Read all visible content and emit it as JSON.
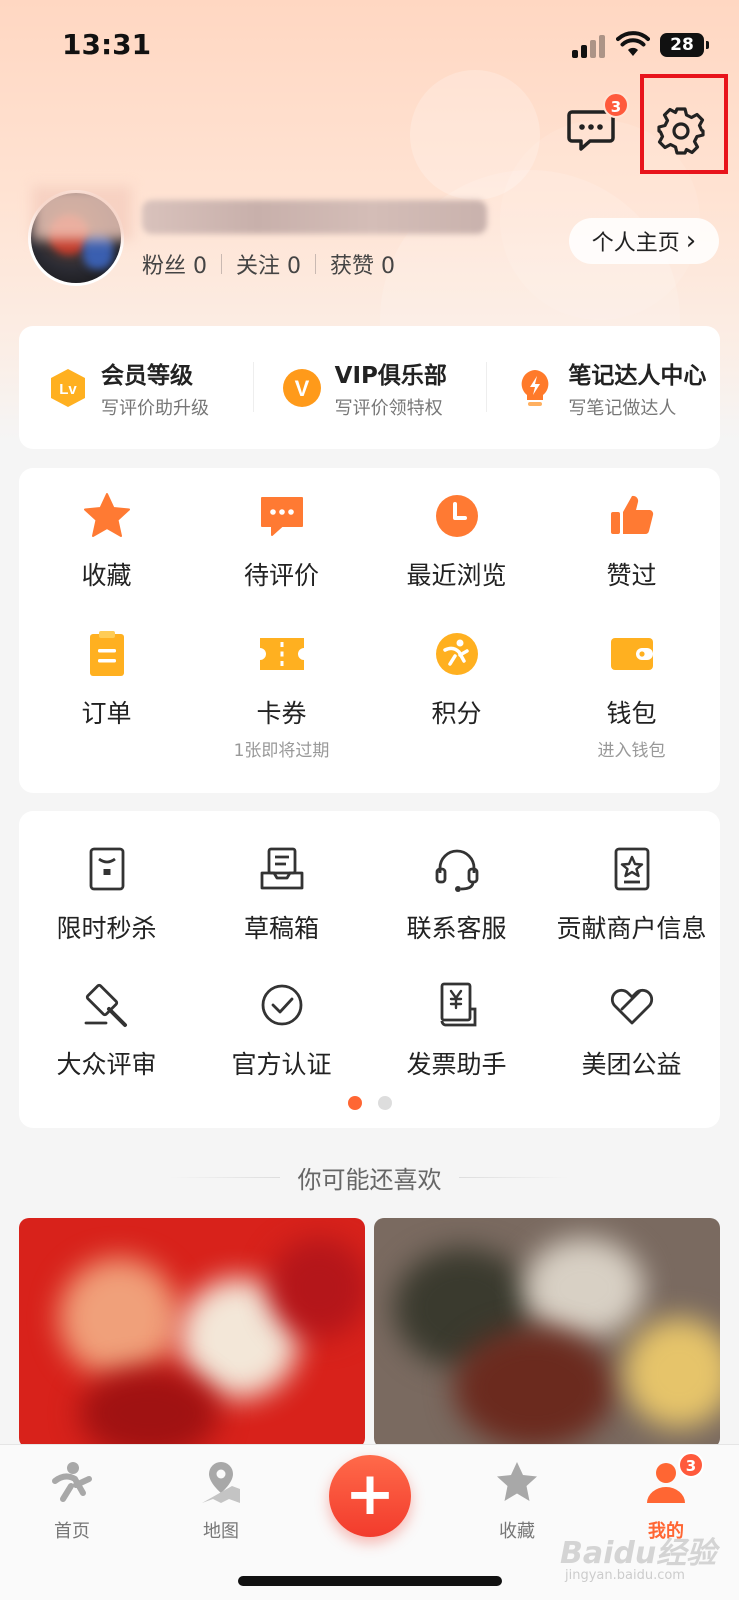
{
  "status_bar": {
    "time": "13:31",
    "battery": "28"
  },
  "header": {
    "message_badge": "3"
  },
  "profile": {
    "stats": [
      {
        "label": "粉丝",
        "value": "0"
      },
      {
        "label": "关注",
        "value": "0"
      },
      {
        "label": "获赞",
        "value": "0"
      }
    ],
    "homepage_label": "个人主页",
    "homepage_chevron": "›"
  },
  "member": [
    {
      "title": "会员等级",
      "subtitle": "写评价助升级",
      "icon": "lv-badge-icon",
      "icon_text": "Lv"
    },
    {
      "title": "VIP俱乐部",
      "subtitle": "写评价领特权",
      "icon": "vip-badge-icon",
      "icon_text": "V"
    },
    {
      "title": "笔记达人中心",
      "subtitle": "写笔记做达人",
      "icon": "bulb-icon"
    }
  ],
  "grid1": [
    {
      "label": "收藏",
      "sub": "",
      "icon": "star-icon"
    },
    {
      "label": "待评价",
      "sub": "",
      "icon": "comment-icon"
    },
    {
      "label": "最近浏览",
      "sub": "",
      "icon": "clock-icon"
    },
    {
      "label": "赞过",
      "sub": "",
      "icon": "thumbs-up-icon"
    },
    {
      "label": "订单",
      "sub": "",
      "icon": "order-icon"
    },
    {
      "label": "卡券",
      "sub": "1张即将过期",
      "icon": "ticket-icon"
    },
    {
      "label": "积分",
      "sub": "",
      "icon": "points-icon"
    },
    {
      "label": "钱包",
      "sub": "进入钱包",
      "icon": "wallet-icon"
    }
  ],
  "grid2": [
    {
      "label": "限时秒杀",
      "icon": "flash-sale-icon"
    },
    {
      "label": "草稿箱",
      "icon": "drafts-icon"
    },
    {
      "label": "联系客服",
      "icon": "headset-icon"
    },
    {
      "label": "贡献商户信息",
      "icon": "merchant-icon"
    },
    {
      "label": "大众评审",
      "icon": "gavel-icon"
    },
    {
      "label": "官方认证",
      "icon": "verified-icon"
    },
    {
      "label": "发票助手",
      "icon": "invoice-icon"
    },
    {
      "label": "美团公益",
      "icon": "charity-icon"
    }
  ],
  "recommend": {
    "title": "你可能还喜欢"
  },
  "tabbar": {
    "tabs": [
      {
        "label": "首页",
        "icon": "home-icon"
      },
      {
        "label": "地图",
        "icon": "map-icon"
      },
      {
        "label": "收藏",
        "icon": "favorites-icon"
      },
      {
        "label": "我的",
        "icon": "profile-icon"
      }
    ],
    "plus": "+",
    "badge": "3"
  },
  "watermark": {
    "main": "Baidu经验",
    "sub": "jingyan.baidu.com"
  },
  "colors": {
    "accent": "#ff6633",
    "badge": "#ff5a3c",
    "highlight_box": "#e8141b"
  }
}
